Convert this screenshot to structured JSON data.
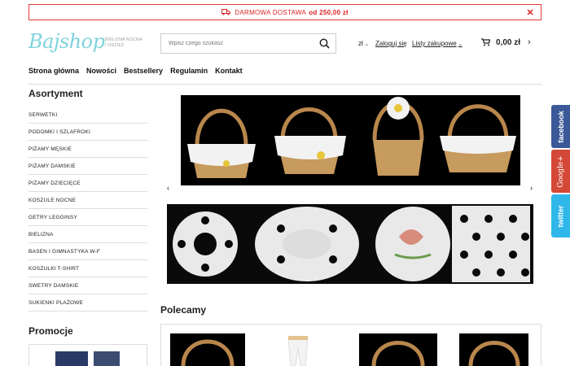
{
  "banner": {
    "text": "DARMOWA DOSTAWA",
    "amount": "od 250,00 zł",
    "close": "✕"
  },
  "logo": {
    "name": "Bajshop",
    "tagline_1": "BIELIZNA NOCNA",
    "tagline_2": "I ODZIEŻ"
  },
  "search": {
    "placeholder": "Wpisz czego szukasz"
  },
  "utility": {
    "currency": "zł",
    "login": "Zaloguj się",
    "lists": "Listy zakupowe"
  },
  "cart": {
    "total": "0,00 zł"
  },
  "nav": [
    "Strona główna",
    "Nowości",
    "Bestsellery",
    "Regulamin",
    "Kontakt"
  ],
  "sidebar": {
    "title": "Asortyment",
    "items": [
      "SERWETKI",
      "PODOMKI I SZLAFROKI",
      "PIŻAMY MĘSKIE",
      "PIŻAMY DAMSKIE",
      "PIŻAMY DZIECIĘCE",
      "KOSZULE NOCNE",
      "GETRY LEGGINSY",
      "BIELIZNA",
      "BASEN I GIMNASTYKA W-F",
      "KOSZULKI T-SHIRT",
      "SWETRY DAMSKIE",
      "SUKIENKI PLAŻOWE"
    ],
    "promo_title": "Promocje"
  },
  "slider": {
    "prev": "‹",
    "next": "›"
  },
  "recommended": {
    "title": "Polecamy"
  },
  "social": {
    "facebook": "facebook",
    "google": "Google+",
    "twitter": "twitter"
  },
  "colors": {
    "accent": "#e53a3a",
    "logo": "#7fd3dc",
    "facebook": "#3b5998",
    "google": "#d34836",
    "twitter": "#2fb7ea"
  }
}
